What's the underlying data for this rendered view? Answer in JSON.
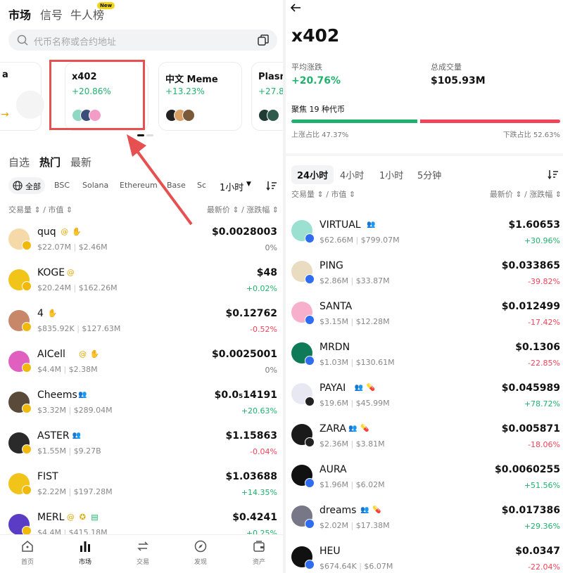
{
  "left": {
    "tabs": [
      "市场",
      "信号",
      "牛人榜"
    ],
    "new_badge": "New",
    "search_placeholder": "代币名称或合约地址",
    "cards": [
      {
        "title": "x402",
        "change": "+20.86%"
      },
      {
        "title": "中文 Meme",
        "change": "+13.23%"
      },
      {
        "title": "Plasm",
        "change": "+27.8"
      }
    ],
    "categories": [
      "自选",
      "热门",
      "最新"
    ],
    "chains": [
      "全部",
      "BSC",
      "Solana",
      "Ethereum",
      "Base",
      "Sc"
    ],
    "timeframe": "1小时",
    "col_left": "交易量 ⇕ / 市值 ⇕",
    "col_right": "最新价 ⇕ / 涨跌幅 ⇕",
    "rows": [
      {
        "name": "quq",
        "vol": "$22.07M",
        "mcap": "$2.46M",
        "price": "$0.0028003",
        "change": "0%",
        "trend": "flat"
      },
      {
        "name": "KOGE",
        "vol": "$20.24M",
        "mcap": "$162.26M",
        "price": "$48",
        "change": "+0.02%",
        "trend": "up"
      },
      {
        "name": "4",
        "vol": "$835.92K",
        "mcap": "$127.63M",
        "price": "$0.12762",
        "change": "-0.52%",
        "trend": "down"
      },
      {
        "name": "AICell",
        "vol": "$4.4M",
        "mcap": "$2.38M",
        "price": "$0.0025001",
        "change": "0%",
        "trend": "flat"
      },
      {
        "name": "Cheems",
        "vol": "$3.32M",
        "mcap": "$289.04M",
        "price": "$0.0₅14191",
        "change": "+20.63%",
        "trend": "up"
      },
      {
        "name": "ASTER",
        "vol": "$1.55M",
        "mcap": "$9.27B",
        "price": "$1.15863",
        "change": "-0.04%",
        "trend": "down"
      },
      {
        "name": "FIST",
        "vol": "$2.22M",
        "mcap": "$197.28M",
        "price": "$1.03688",
        "change": "+14.35%",
        "trend": "up"
      },
      {
        "name": "MERL",
        "vol": "$4.4M",
        "mcap": "$415.18M",
        "price": "$0.4241",
        "change": "+0.25%",
        "trend": "up"
      }
    ],
    "nav": [
      "首页",
      "市场",
      "交易",
      "发现",
      "资产"
    ]
  },
  "right": {
    "back_icon": "arrow-left-icon",
    "title": "x402",
    "avg_change_label": "平均涨跌",
    "avg_change": "+20.76%",
    "volume_label": "总成交量",
    "volume": "$105.93M",
    "focus_text": "聚焦 19 种代币",
    "up_ratio": 0.4737,
    "up_label": "上涨占比 47.37%",
    "down_label": "下跌占比 52.63%",
    "time_tabs": [
      "24小时",
      "4小时",
      "1小时",
      "5分钟"
    ],
    "col_left": "交易量 ⇕ / 市值 ⇕",
    "col_right": "最新价 ⇕ / 涨跌幅 ⇕",
    "rows": [
      {
        "name": "VIRTUAL",
        "vol": "$62.66M",
        "mcap": "$799.07M",
        "price": "$1.60653",
        "change": "+30.96%",
        "trend": "up"
      },
      {
        "name": "PING",
        "vol": "$2.86M",
        "mcap": "$33.87M",
        "price": "$0.033865",
        "change": "-39.82%",
        "trend": "down"
      },
      {
        "name": "SANTA",
        "vol": "$3.15M",
        "mcap": "$12.28M",
        "price": "$0.012499",
        "change": "-17.42%",
        "trend": "down"
      },
      {
        "name": "MRDN",
        "vol": "$1.03M",
        "mcap": "$130.61M",
        "price": "$0.1306",
        "change": "-22.85%",
        "trend": "down"
      },
      {
        "name": "PAYAI",
        "vol": "$19.6M",
        "mcap": "$45.99M",
        "price": "$0.045989",
        "change": "+78.72%",
        "trend": "up"
      },
      {
        "name": "ZARA",
        "vol": "$2.36M",
        "mcap": "$3.81M",
        "price": "$0.005871",
        "change": "-18.06%",
        "trend": "down"
      },
      {
        "name": "AURA",
        "vol": "$1.96M",
        "mcap": "$6.02M",
        "price": "$0.0060255",
        "change": "+51.56%",
        "trend": "up"
      },
      {
        "name": "dreams",
        "vol": "$2.02M",
        "mcap": "$17.38M",
        "price": "$0.017386",
        "change": "+29.36%",
        "trend": "up"
      },
      {
        "name": "HEU",
        "vol": "$674.64K",
        "mcap": "$6.07M",
        "price": "$0.0347",
        "change": "-22.04%",
        "trend": "down"
      }
    ]
  },
  "colors": {
    "up": "#20b26c",
    "down": "#f0445a",
    "highlight": "#e65050"
  }
}
